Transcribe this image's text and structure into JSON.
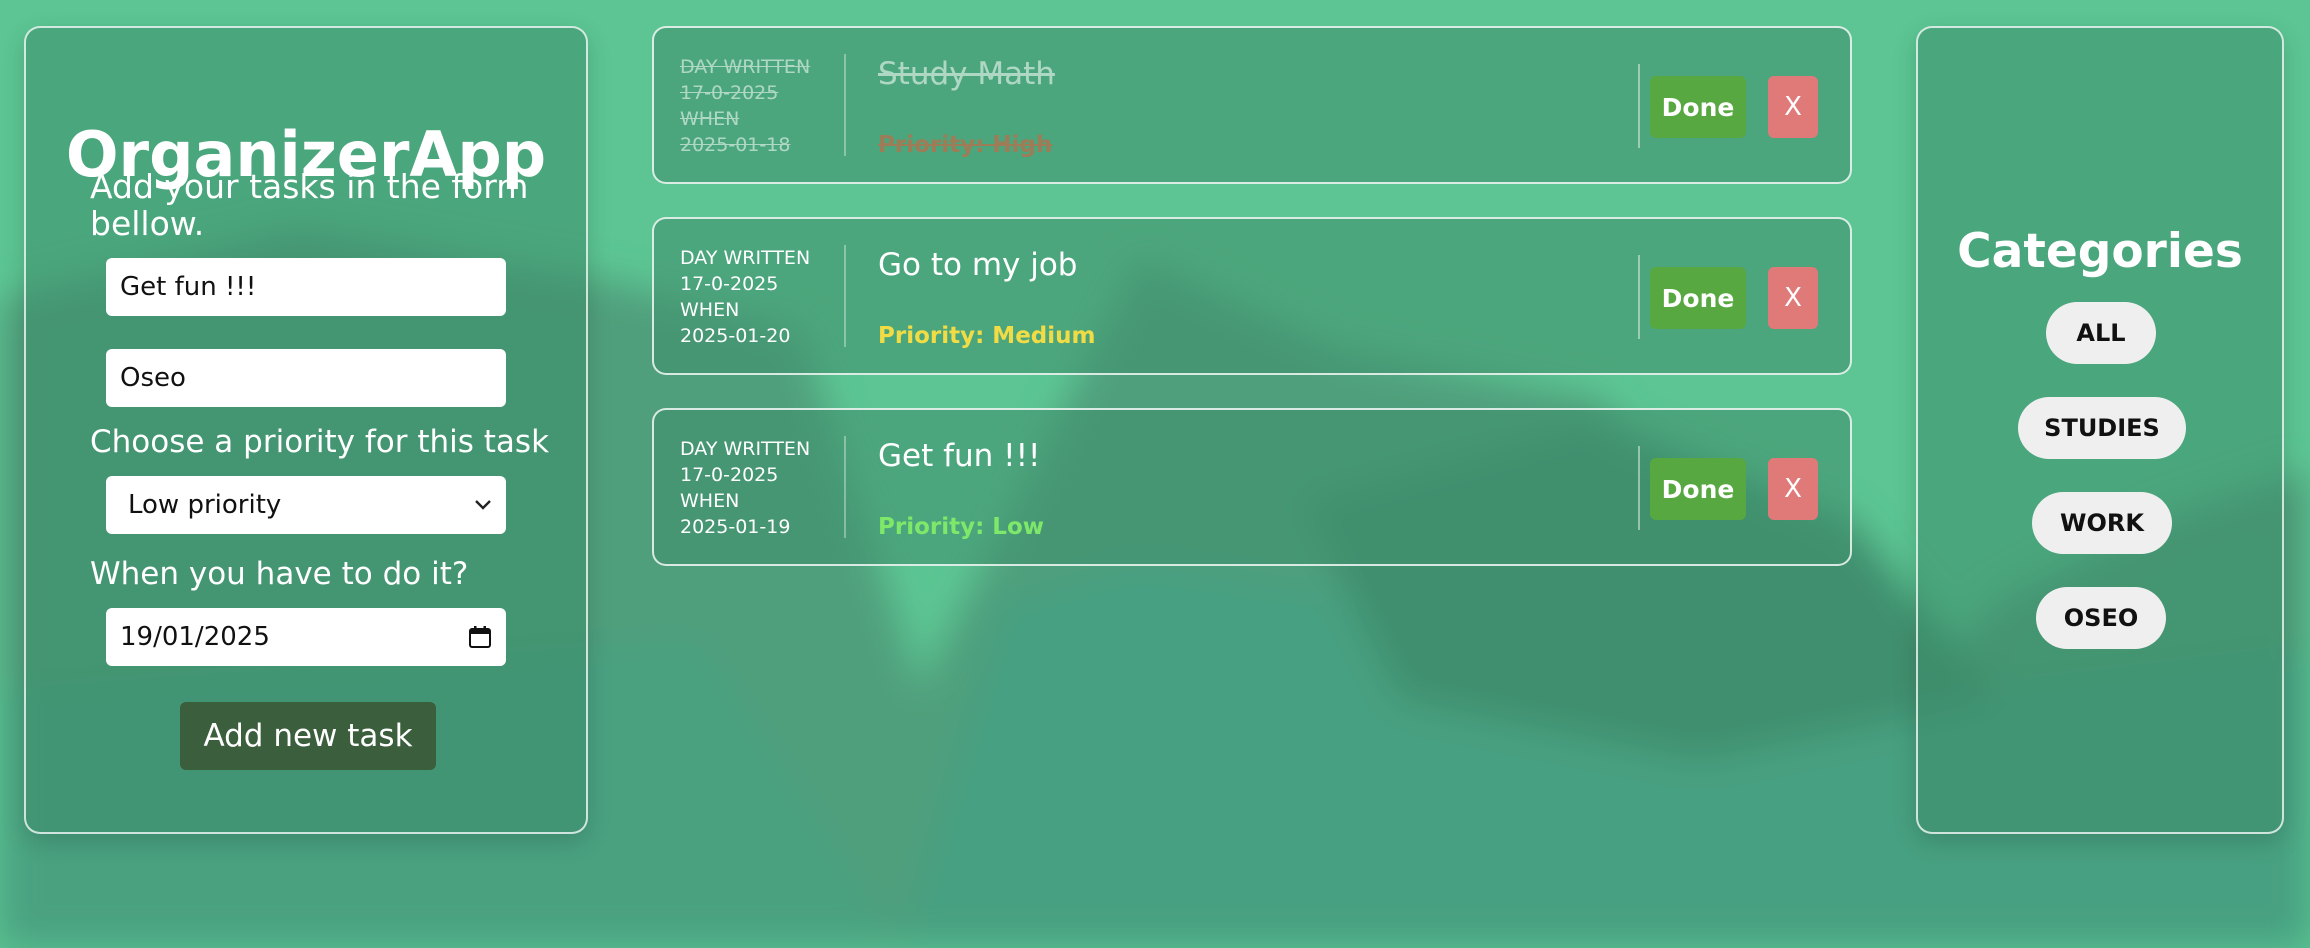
{
  "app": {
    "title": "OrganizerApp",
    "subtitle": "Add your tasks in the form bellow."
  },
  "form": {
    "title_value": "Get fun !!!",
    "category_value": "Oseo",
    "priority_label": "Choose a priority for this task",
    "priority_selected": "Low priority",
    "date_label": "When you have to do it?",
    "date_value": "19/01/2025",
    "submit_label": "Add new task"
  },
  "tasks": [
    {
      "meta_written_label": "DAY WRITTEN",
      "meta_written": "17-0-2025",
      "meta_when_label": "WHEN",
      "meta_when": "2025-01-18",
      "title": "Study Math",
      "priority": "Priority: High",
      "priority_color": "#e05a3a",
      "completed": true,
      "done_label": "Done",
      "delete_label": "X"
    },
    {
      "meta_written_label": "DAY WRITTEN",
      "meta_written": "17-0-2025",
      "meta_when_label": "WHEN",
      "meta_when": "2025-01-20",
      "title": "Go to my job",
      "priority": "Priority: Medium",
      "priority_color": "#f2dc45",
      "completed": false,
      "done_label": "Done",
      "delete_label": "X"
    },
    {
      "meta_written_label": "DAY WRITTEN",
      "meta_written": "17-0-2025",
      "meta_when_label": "WHEN",
      "meta_when": "2025-01-19",
      "title": "Get fun !!!",
      "priority": "Priority: Low",
      "priority_color": "#7ee86a",
      "completed": false,
      "done_label": "Done",
      "delete_label": "X"
    }
  ],
  "categories": {
    "title": "Categories",
    "items": [
      "ALL",
      "STUDIES",
      "WORK",
      "OSEO"
    ]
  },
  "colors": {
    "background": "#4fa887",
    "done_button": "#58a842",
    "delete_button": "#e07a78",
    "add_button": "#3b5e3c"
  },
  "icons": {
    "priority_select": "chevron-down-icon",
    "date_input": "calendar-icon"
  }
}
